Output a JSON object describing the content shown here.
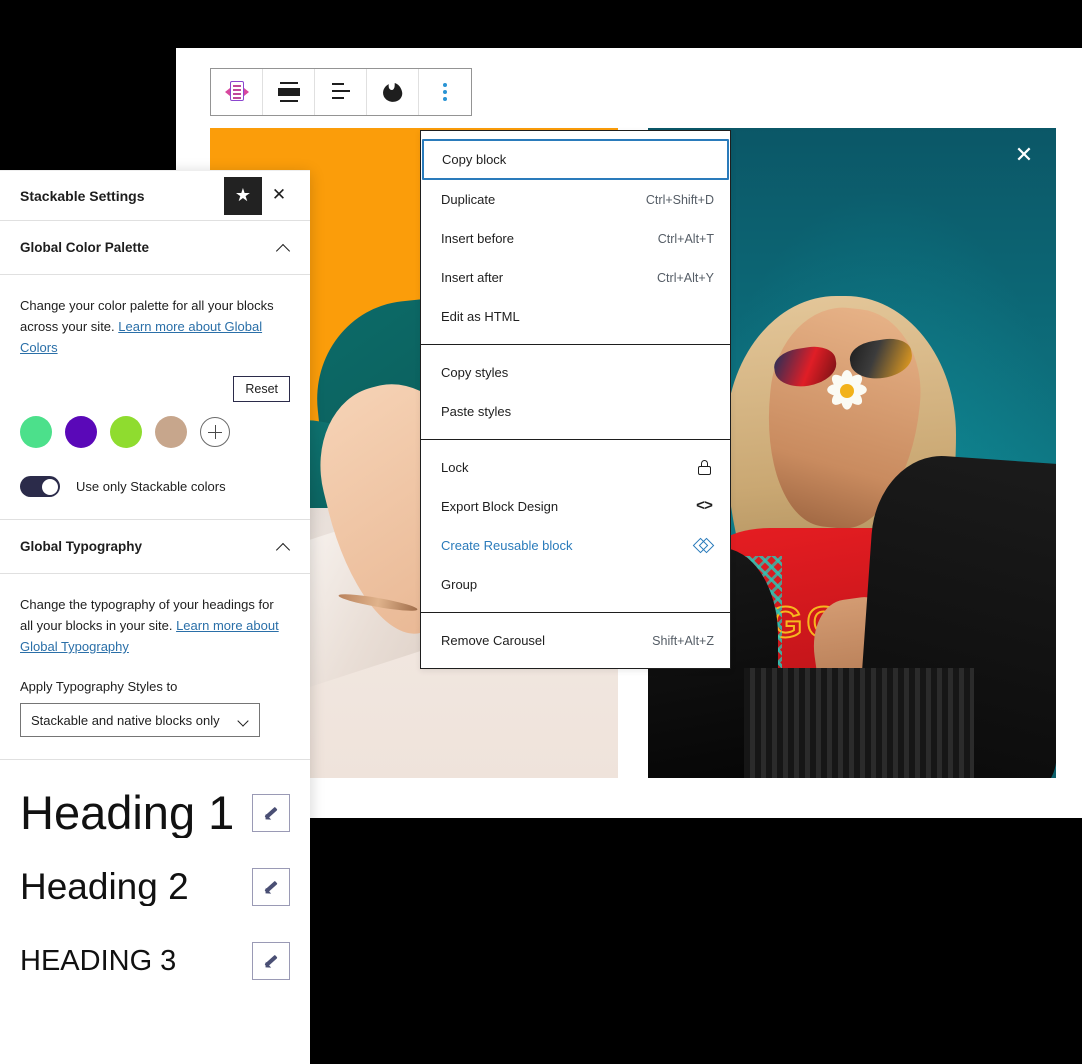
{
  "toolbar": {
    "buttons": [
      {
        "name": "stackable-block-icon",
        "label": "Stackable block"
      },
      {
        "name": "vertical-align-icon",
        "label": "Change vertical alignment"
      },
      {
        "name": "align-text-left-icon",
        "label": "Align text left"
      },
      {
        "name": "blob-icon",
        "label": "Block style"
      },
      {
        "name": "more-options-icon",
        "label": "Options"
      }
    ]
  },
  "dropdown": {
    "groups": [
      {
        "items": [
          {
            "label": "Copy block",
            "shortcut": "",
            "icon": "",
            "focused": true,
            "accent": false
          },
          {
            "label": "Duplicate",
            "shortcut": "Ctrl+Shift+D",
            "icon": "",
            "focused": false,
            "accent": false
          },
          {
            "label": "Insert before",
            "shortcut": "Ctrl+Alt+T",
            "icon": "",
            "focused": false,
            "accent": false
          },
          {
            "label": "Insert after",
            "shortcut": "Ctrl+Alt+Y",
            "icon": "",
            "focused": false,
            "accent": false
          },
          {
            "label": "Edit as HTML",
            "shortcut": "",
            "icon": "",
            "focused": false,
            "accent": false
          }
        ]
      },
      {
        "items": [
          {
            "label": "Copy styles",
            "shortcut": "",
            "icon": "",
            "focused": false,
            "accent": false
          },
          {
            "label": "Paste styles",
            "shortcut": "",
            "icon": "",
            "focused": false,
            "accent": false
          }
        ]
      },
      {
        "items": [
          {
            "label": "Lock",
            "shortcut": "",
            "icon": "lock",
            "focused": false,
            "accent": false
          },
          {
            "label": "Export Block Design",
            "shortcut": "",
            "icon": "code",
            "focused": false,
            "accent": false
          },
          {
            "label": "Create Reusable block",
            "shortcut": "",
            "icon": "reusable",
            "focused": false,
            "accent": true
          },
          {
            "label": "Group",
            "shortcut": "",
            "icon": "",
            "focused": false,
            "accent": false
          }
        ]
      },
      {
        "items": [
          {
            "label": "Remove Carousel",
            "shortcut": "Shift+Alt+Z",
            "icon": "",
            "focused": false,
            "accent": false
          }
        ]
      }
    ]
  },
  "settings_panel": {
    "title": "Stackable Settings",
    "pro_badge": "★",
    "close_glyph": "✕",
    "color_section": {
      "title": "Global Color Palette",
      "description_before": "Change your color palette for all your blocks across your site. ",
      "link_text": "Learn more about Global Colors",
      "reset_label": "Reset",
      "swatches": [
        "#4ce08b",
        "#5a08b8",
        "#8fdc2f",
        "#c7a68c"
      ],
      "add_swatch_label": "+",
      "toggle_label": "Use only Stackable colors",
      "toggle_on": true
    },
    "typography_section": {
      "title": "Global Typography",
      "description_before": "Change the typography of your headings for all your blocks in your site. ",
      "link_text": "Learn more about Global Typography",
      "apply_label": "Apply Typography Styles to",
      "select_value": "Stackable and native blocks only",
      "headings": [
        {
          "sample": "Heading 1",
          "edit_label": "Edit"
        },
        {
          "sample": "Heading 2",
          "edit_label": "Edit"
        },
        {
          "sample": "HEADING 3",
          "edit_label": "Edit"
        }
      ]
    }
  },
  "carousel": {
    "close_glyph": "✕",
    "slides": [
      {
        "name": "slide-orange",
        "alt": "Woman with red sunglasses on orange background"
      },
      {
        "name": "slide-teal",
        "alt": "Woman with colorful sunglasses and daisy on teal background"
      }
    ],
    "shirt_text": "GGG"
  },
  "colors": {
    "accent_blue": "#2a7bbb",
    "link_blue": "#2a6fa8",
    "orange": "#fb9d0a",
    "teal": "#0e7a86",
    "toggle_navy": "#2b2b4a"
  }
}
